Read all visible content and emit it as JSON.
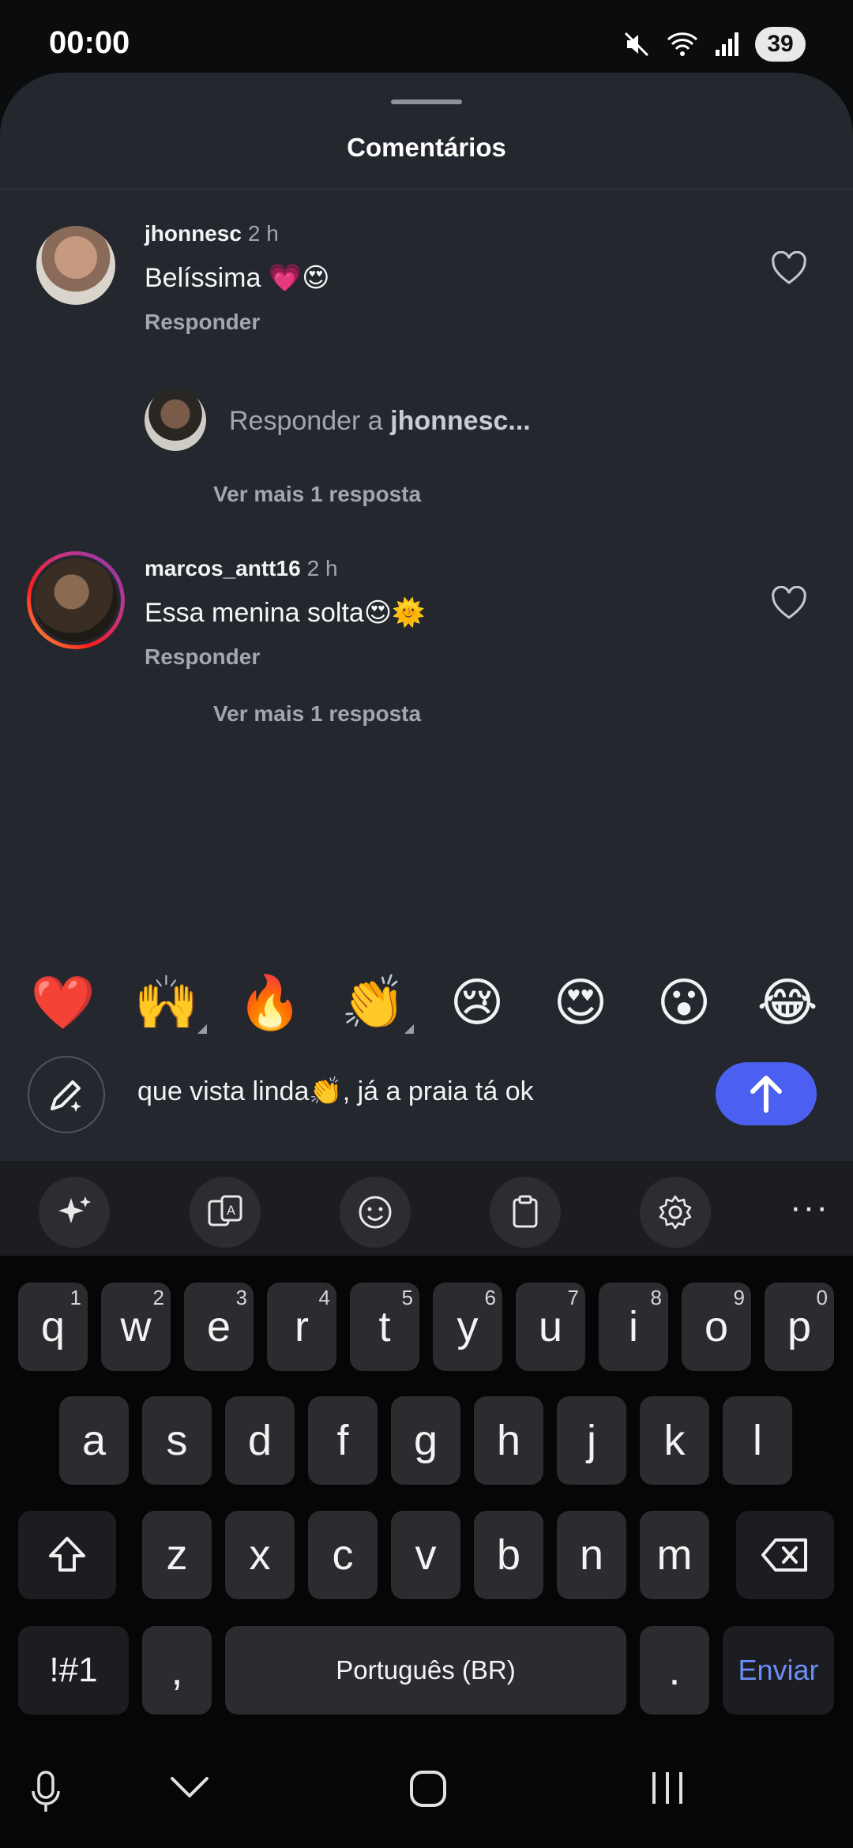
{
  "status_bar": {
    "time": "00:00",
    "battery": "39"
  },
  "sheet": {
    "title": "Comentários",
    "comments": [
      {
        "username": "jhonnesc",
        "time": "2 h",
        "text": "Belíssima 💗😍",
        "reply_label": "Responder"
      },
      {
        "username": "marcos_antt16",
        "time": "2 h",
        "text": "Essa menina solta😍🌞",
        "reply_label": "Responder"
      }
    ],
    "reply_prompt": {
      "prefix": "Responder a ",
      "target": "jhonnesc..."
    },
    "view_more_1": "Ver mais 1 resposta",
    "view_more_2": "Ver mais 1 resposta"
  },
  "emoji_bar": [
    "❤️",
    "🙌",
    "🔥",
    "👏",
    "😢",
    "😍",
    "😮",
    "😂"
  ],
  "input": {
    "value": "que vista linda👏, já a praia tá ok"
  },
  "keyboard": {
    "row1": [
      {
        "key": "q",
        "num": "1"
      },
      {
        "key": "w",
        "num": "2"
      },
      {
        "key": "e",
        "num": "3"
      },
      {
        "key": "r",
        "num": "4"
      },
      {
        "key": "t",
        "num": "5"
      },
      {
        "key": "y",
        "num": "6"
      },
      {
        "key": "u",
        "num": "7"
      },
      {
        "key": "i",
        "num": "8"
      },
      {
        "key": "o",
        "num": "9"
      },
      {
        "key": "p",
        "num": "0"
      }
    ],
    "row2": [
      "a",
      "s",
      "d",
      "f",
      "g",
      "h",
      "j",
      "k",
      "l"
    ],
    "row3": [
      "z",
      "x",
      "c",
      "v",
      "b",
      "n",
      "m"
    ],
    "symbols": "!#1",
    "comma": ",",
    "space": "Português (BR)",
    "period": ".",
    "enter": "Enviar",
    "more": "···"
  },
  "colors": {
    "sheet_bg": "#24272d",
    "send_button": "#4b5ff0",
    "enter_text": "#6c8df7"
  }
}
